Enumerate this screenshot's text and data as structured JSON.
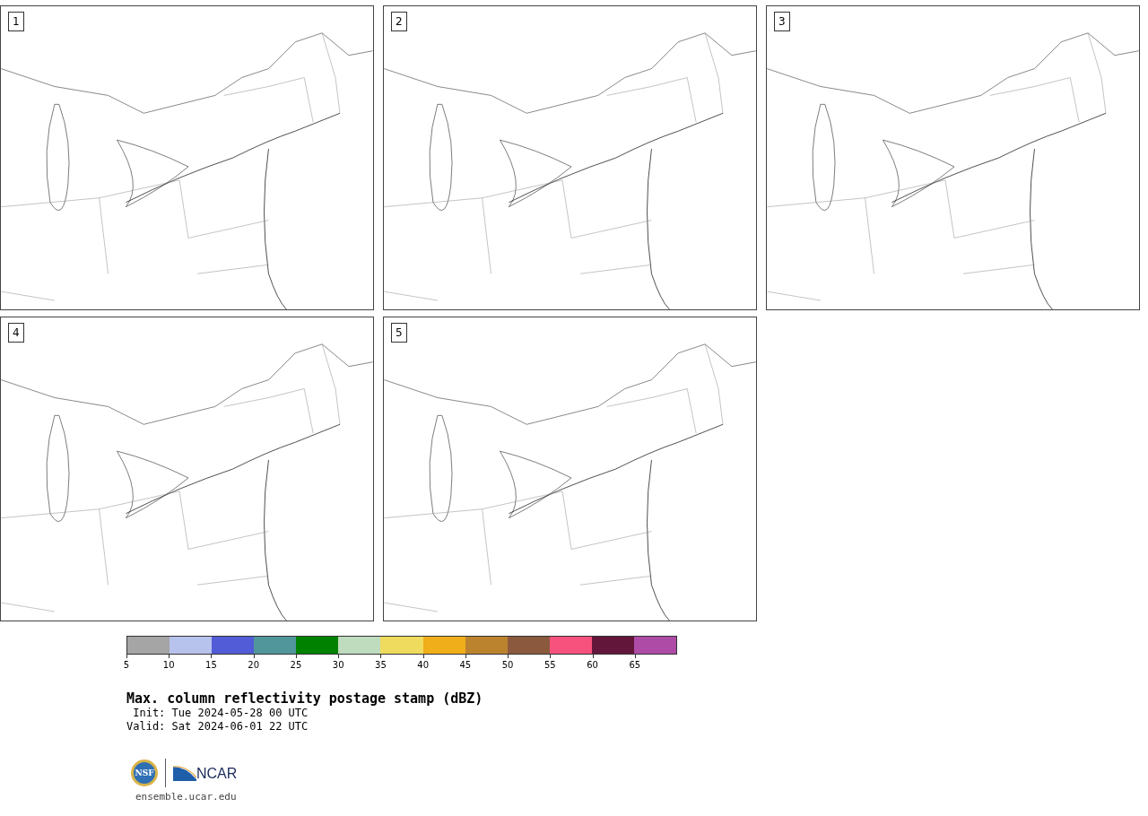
{
  "panels": [
    {
      "label": "1"
    },
    {
      "label": "2"
    },
    {
      "label": "3"
    },
    {
      "label": "4"
    },
    {
      "label": "5"
    }
  ],
  "colorbar": {
    "segments": [
      {
        "label": "5",
        "color": "#a5a5a5"
      },
      {
        "label": "10",
        "color": "#b7c3ec"
      },
      {
        "label": "15",
        "color": "#525cd6"
      },
      {
        "label": "20",
        "color": "#50969a"
      },
      {
        "label": "25",
        "color": "#008200"
      },
      {
        "label": "30",
        "color": "#bfdcbe"
      },
      {
        "label": "35",
        "color": "#efdb5d"
      },
      {
        "label": "40",
        "color": "#efae1a"
      },
      {
        "label": "45",
        "color": "#bc832f"
      },
      {
        "label": "50",
        "color": "#8b5a3e"
      },
      {
        "label": "55",
        "color": "#f7517e"
      },
      {
        "label": "60",
        "color": "#62173a"
      },
      {
        "label": "65",
        "color": "#ad4ba6"
      }
    ]
  },
  "title": "Max. column reflectivity postage stamp (dBZ)",
  "init": " Init: Tue 2024-05-28 00 UTC",
  "valid": "Valid: Sat 2024-06-01 22 UTC",
  "logo": {
    "left": "NSF",
    "right": "NCAR"
  },
  "footer": "ensemble.ucar.edu"
}
